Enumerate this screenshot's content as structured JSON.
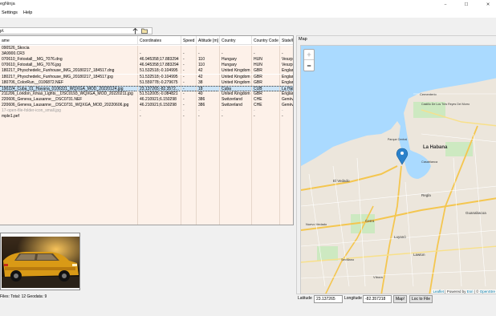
{
  "window": {
    "title": "egNinja",
    "controls": {
      "minimize": "−",
      "maximize": "☐",
      "close": "✕"
    }
  },
  "menu": {
    "items": [
      "Settings",
      "Help"
    ]
  },
  "path": {
    "value": "p\\",
    "up_icon": "arrow-up-icon",
    "browse_icon": "folder-icon"
  },
  "grid": {
    "columns": [
      "ame",
      "Coordinates",
      "Speed",
      "Altitude [m]",
      "Country",
      "Country Code",
      "State/P"
    ],
    "rows": [
      {
        "cells": [
          "090526_Skocia",
          "",
          "",
          "",
          "",
          "",
          ""
        ]
      },
      {
        "cells": [
          "3A9900.CR3",
          "-",
          "-",
          "-",
          "-",
          "-",
          "-"
        ]
      },
      {
        "cells": [
          "070610_Fotostall__MG_7076.dng",
          "46.945358;17.883294",
          "-",
          "110",
          "Hungary",
          "HUN",
          "Veszpr"
        ]
      },
      {
        "cells": [
          "070610_Fotostall__MG_7076.jpg",
          "46.945358;17.883294",
          "-",
          "110",
          "Hungary",
          "HUN",
          "Veszpr"
        ]
      },
      {
        "cells": [
          "180217_Physchedelic_Funhouse_IMG_20180217_184517.dng",
          "51.532518;-0.104995",
          "-",
          "42",
          "United Kingdom",
          "GBR",
          "Englan"
        ]
      },
      {
        "cells": [
          "180217_Physchedelic_Funhouse_IMG_20180217_184517.jpg",
          "51.532518;-0.104995",
          "-",
          "42",
          "United Kingdom",
          "GBR",
          "Englan"
        ]
      },
      {
        "cells": [
          "180706_ColorRun__0106872.NEF",
          "51.559778;-0.279675",
          "-",
          "38",
          "United Kingdom",
          "GBR",
          "Englan"
        ]
      },
      {
        "cells": [
          "190224_Cuba_01_Havana_0106321_WQXGA_MOD_20220124.jpg",
          "23.137265;-82.3572...",
          "-",
          "18",
          "Cuba",
          "CUB",
          "La Hab"
        ],
        "selected": true
      },
      {
        "cells": [
          "211206_London_Xmas_Lights__DSC0193_WQXGA_MOD_20220211.jpg",
          "51.512005;-0.084821",
          "-",
          "40",
          "United Kingdom",
          "GBR",
          "Englan"
        ]
      },
      {
        "cells": [
          "220606_Geneva_Lausanne__DSC0731.NEF",
          "46.210921;6.150298",
          "-",
          "386",
          "Switzerland",
          "CHE",
          "Genève"
        ]
      },
      {
        "cells": [
          "220606_Geneva_Lausanne__DSC0731_WQXGA_MOD_20220606.jpg",
          "46.210921;6.150298",
          "-",
          "386",
          "Switzerland",
          "CHE",
          "Genève"
        ]
      },
      {
        "cells": [
          "17-open-file-folder-icon_small.jpg",
          "-",
          "-",
          "-",
          "-",
          "-",
          "-"
        ],
        "faint": true
      },
      {
        "cells": [
          "mple1.pef",
          "-",
          "-",
          "-",
          "-",
          "-",
          "-"
        ]
      }
    ]
  },
  "status": {
    "text": "Files: Total: 12 Geodata: 9"
  },
  "map": {
    "tab_label": "Map",
    "zoom_in": "+",
    "zoom_out": "−",
    "city_label": "La Habana",
    "place_labels": [
      "Castillo De Los Tres Reyes Del Morro",
      "Cementerio",
      "El Vedado",
      "Cerro",
      "Luyanó",
      "Lawton",
      "Regla",
      "Nuevo Vedado",
      "Guanabacoa",
      "Casablanca",
      "Sevillano",
      "Víbora",
      "Parque Central"
    ],
    "attribution": {
      "leaflet": "Leaflet",
      "mid": " | Powered by ",
      "esri": "Esri",
      "sep": " | © ",
      "osm": "OpenStre"
    },
    "marker_icon": "map-pin-icon"
  },
  "coords": {
    "lat_label": "Latitude",
    "lat_value": "23.137265",
    "lon_label": "Longitude",
    "lon_value": "-82.357218",
    "map_button": "Map!",
    "loc_button": "Loc to File"
  }
}
